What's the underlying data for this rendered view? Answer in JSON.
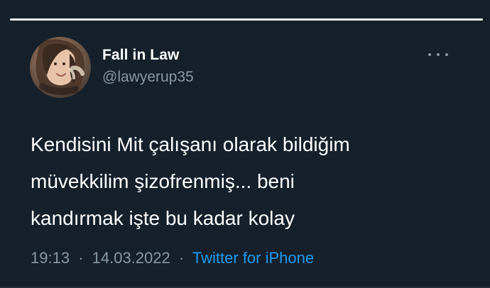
{
  "tweet": {
    "display_name": "Fall in Law",
    "handle": "@lawyerup35",
    "text_lines": [
      "Kendisini Mit çalışanı olarak bildiğim",
      "müvekkilim şizofrenmiş... beni",
      "kandırmak işte bu kadar kolay"
    ],
    "time": "19:13",
    "date": "14.03.2022",
    "source": "Twitter for iPhone",
    "separator": "·"
  },
  "icons": {
    "more": "more-icon"
  },
  "colors": {
    "background": "#15202b",
    "primary_text": "#ffffff",
    "secondary_text": "#8899a6",
    "accent": "#1d9bf0"
  }
}
